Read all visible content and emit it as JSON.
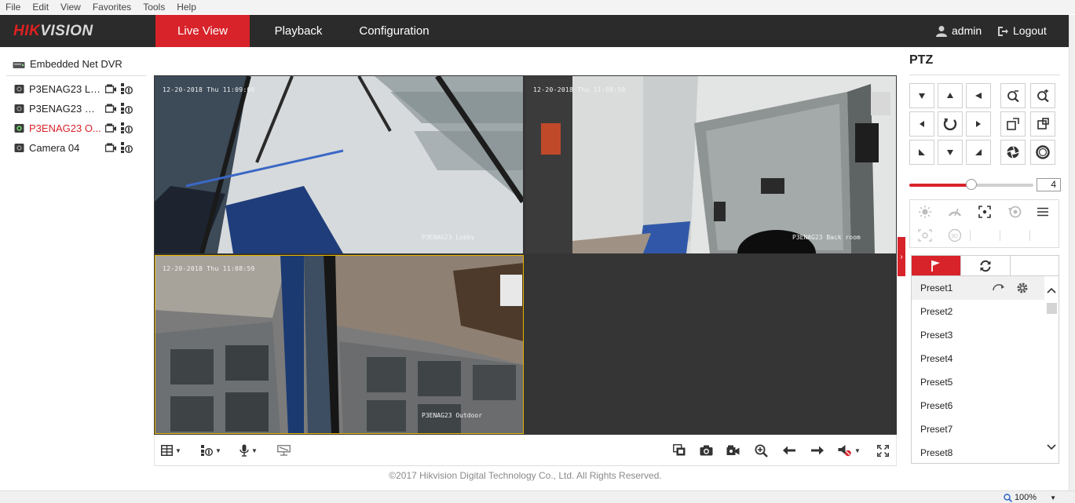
{
  "menu": {
    "items": [
      "File",
      "Edit",
      "View",
      "Favorites",
      "Tools",
      "Help"
    ]
  },
  "brand": {
    "logo_red": "HIK",
    "logo_grey": "VISION",
    "accent": "#d8232a"
  },
  "nav": {
    "tabs": [
      {
        "label": "Live View",
        "active": true
      },
      {
        "label": "Playback",
        "active": false
      },
      {
        "label": "Configuration",
        "active": false
      }
    ],
    "user": "admin",
    "logout": "Logout"
  },
  "tree": {
    "root_label": "Embedded Net DVR",
    "cameras": [
      {
        "name": "P3ENAG23 Lo...",
        "active": false
      },
      {
        "name": "P3ENAG23 Ba...",
        "active": false
      },
      {
        "name": "P3ENAG23 O...",
        "active": true
      },
      {
        "name": "Camera 04",
        "active": false
      }
    ]
  },
  "video": {
    "panes": [
      {
        "timestamp": "12-20-2018 Thu 11:09:00",
        "osd_name": "P3ENAG23 Lobby"
      },
      {
        "timestamp": "12-20-2018 Thu 11:08:58",
        "osd_name": "P3ENAG23 Back room"
      },
      {
        "timestamp": "12-20-2018 Thu 11:08:59",
        "osd_name": "P3ENAG23 Outdoor"
      },
      {
        "timestamp": "",
        "osd_name": ""
      }
    ],
    "selected_pane": 3
  },
  "ptz": {
    "title": "PTZ",
    "speed_value": "4",
    "speed_fraction": 0.5,
    "presets": [
      "Preset1",
      "Preset2",
      "Preset3",
      "Preset4",
      "Preset5",
      "Preset6",
      "Preset7",
      "Preset8"
    ],
    "selected_preset": "Preset1"
  },
  "footer": {
    "copyright": "©2017 Hikvision Digital Technology Co., Ltd. All Rights Reserved."
  },
  "statusbar": {
    "zoom": "100%"
  }
}
